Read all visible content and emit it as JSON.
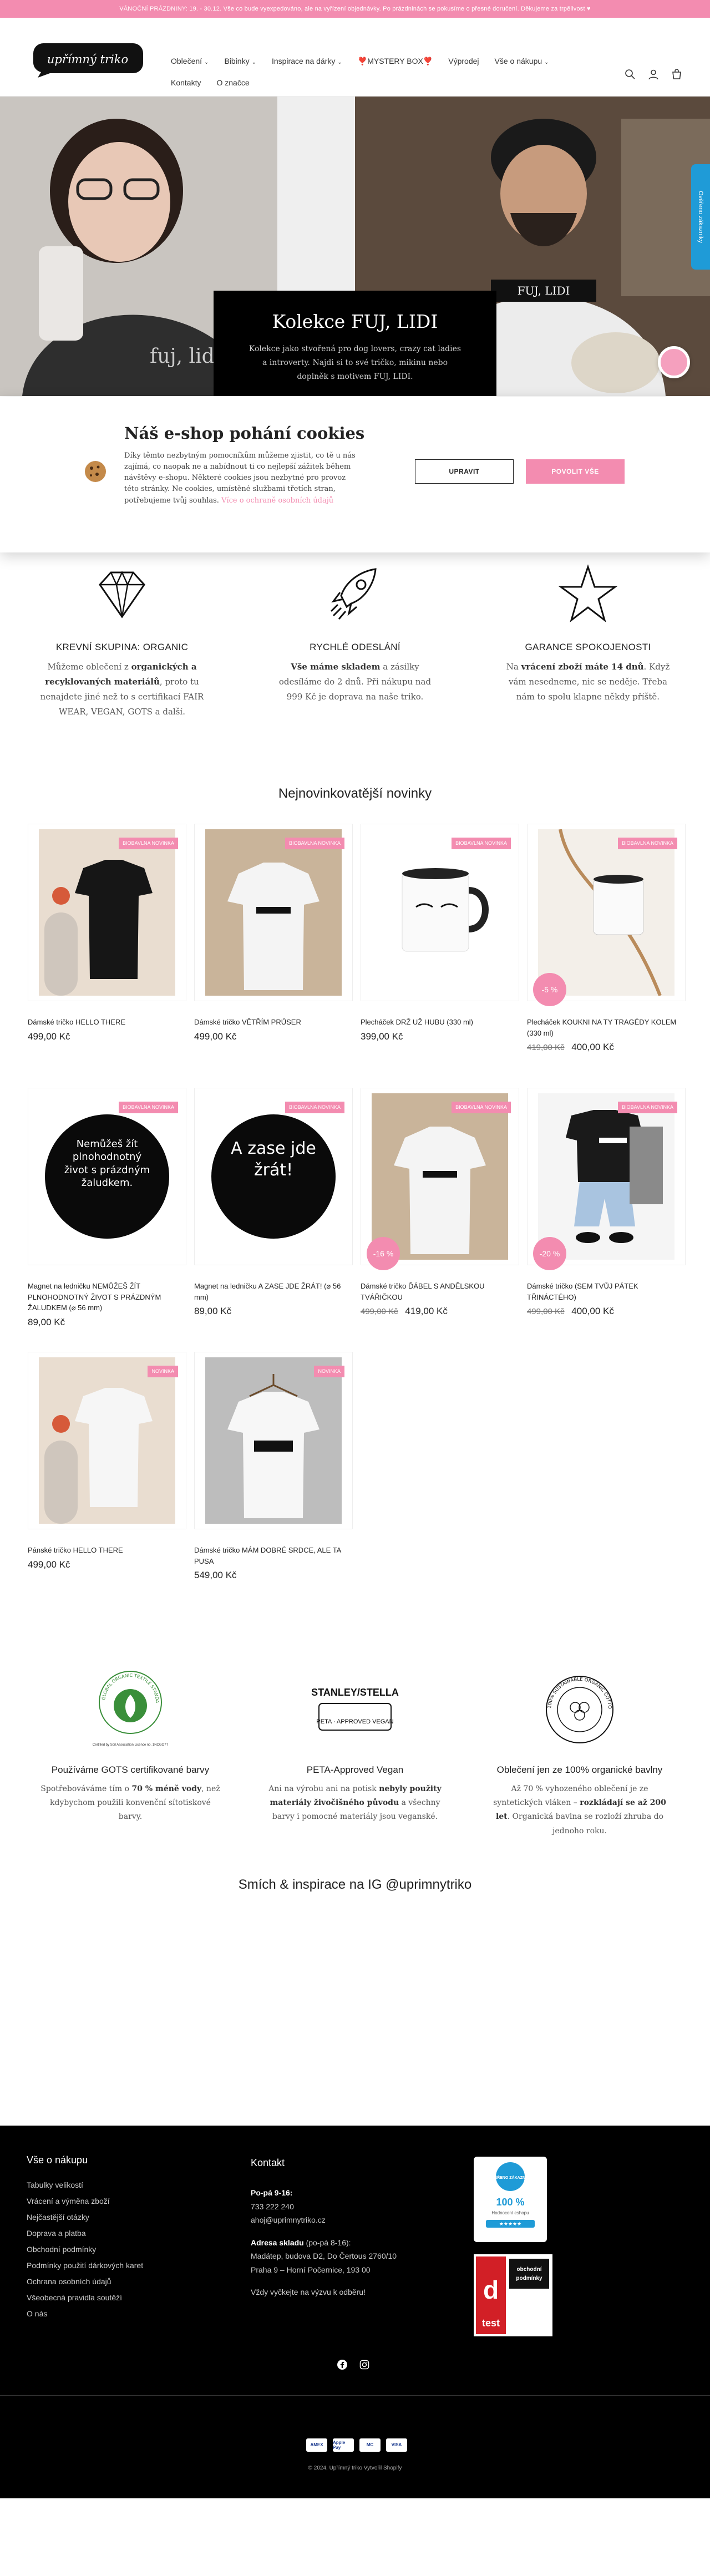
{
  "announcement": "VÁNOČNÍ PRÁZDNINY: 19. - 30.12. Vše co bude vyexpedováno, ale na vyřízení objednávky. Po prázdninách se pokusíme o přesné doručení. Děkujeme za trpělivost ♥",
  "header": {
    "logo_text": "upřímný triko",
    "nav_row1": [
      "Oblečení",
      "Bibinky",
      "Inspirace na dárky",
      "❣️MYSTERY BOX❣️",
      "Výprodej",
      "Vše o nákupu"
    ],
    "nav_row2": [
      "Kontakty",
      "O značce"
    ]
  },
  "hero": {
    "title": "Kolekce FUJ, LIDI",
    "text": "Kolekce jako stvořená pro dog lovers, crazy cat ladies a introverty. Najdi si to své tričko, mikinu nebo doplněk s motivem FUJ, LIDI.",
    "shirt_left": "fuj, lidi",
    "shirt_right": "FUJ, LIDI",
    "side_badge": "Ověřeno zákazníky"
  },
  "cookie": {
    "title": "Náš e-shop pohání cookies",
    "text": "Díky těmto nezbytným pomocníkům můžeme zjistit, co tě u nás zajímá, co naopak ne a nabídnout ti co nejlepší zážitek během návštěvy e-shopu. Některé cookies jsou nezbytné pro provoz této stránky. Ne cookies, umístěné službami třetích stran, potřebujeme tvůj souhlas.",
    "link": "Více o ochraně osobních údajů",
    "upravit": "UPRAVIT",
    "povolit": "POVOLIT VŠE"
  },
  "features": [
    {
      "title": "KREVNÍ SKUPINA: ORGANIC",
      "text_pre": "Můžeme oblečení z ",
      "bold": "organických a recyklovaných materiálů",
      "text_post": ", proto tu nenajdete jiné než to s certifikací FAIR WEAR, VEGAN, GOTS a další."
    },
    {
      "title": "RYCHLÉ ODESLÁNÍ",
      "text_pre": "",
      "bold": "Vše máme skladem",
      "text_post": " a zásilky odesíláme do 2 dnů. Při nákupu nad 999 Kč je doprava na naše triko."
    },
    {
      "title": "GARANCE SPOKOJENOSTI",
      "text_pre": "Na ",
      "bold": "vrácení zboží máte 14 dnů",
      "text_post": ". Když vám nesedneme, nic se neděje. Třeba nám to spolu klapne někdy příště."
    }
  ],
  "new_title": "Nejnovinkovatější novinky",
  "products": [
    {
      "name": "Dámské tričko HELLO THERE",
      "price": "499,00 Kč",
      "old": "",
      "tag": "BIOBAVLNA NOVINKA",
      "sale": "",
      "img": "tee-black"
    },
    {
      "name": "Dámské tričko VĚTŘÍM PRŮSER",
      "price": "499,00 Kč",
      "old": "",
      "tag": "BIOBAVLNA NOVINKA",
      "sale": "",
      "img": "tee-white"
    },
    {
      "name": "Plecháček DRŽ UŽ HUBU (330 ml)",
      "price": "399,00 Kč",
      "old": "",
      "tag": "BIOBAVLNA NOVINKA",
      "sale": "",
      "img": "mug"
    },
    {
      "name": "Plecháček KOUKNI NA TY TRAGÉDY KOLEM (330 ml)",
      "price": "400,00 Kč",
      "old": "419,00 Kč",
      "tag": "BIOBAVLNA NOVINKA",
      "sale": "-5 %",
      "img": "mug-hang"
    },
    {
      "name": "Magnet na ledničku NEMŮŽEŠ ŽÍT PLNOHODNOTNÝ ŽIVOT S PRÁZDNÝM ŽALUDKEM (⌀ 56 mm)",
      "price": "89,00 Kč",
      "old": "",
      "tag": "BIOBAVLNA NOVINKA",
      "sale": "",
      "img": "magnet1",
      "magnet_text": "Nemůžeš žít plnohodnotný život s prázdným žaludkem."
    },
    {
      "name": "Magnet na ledničku A ZASE JDE ŽRÁT! (⌀ 56 mm)",
      "price": "89,00 Kč",
      "old": "",
      "tag": "BIOBAVLNA NOVINKA",
      "sale": "",
      "img": "magnet2",
      "magnet_text": "A zase jde žrát!"
    },
    {
      "name": "Dámské tričko ĎÁBEL S ANDĚLSKOU TVÁŘIČKOU",
      "price": "419,00 Kč",
      "old": "499,00 Kč",
      "tag": "BIOBAVLNA NOVINKA",
      "sale": "-16 %",
      "img": "tee-white"
    },
    {
      "name": "Dámské tričko (SEM TVŮJ PÁTEK TŘINÁCTÉHO)",
      "price": "400,00 Kč",
      "old": "499,00 Kč",
      "tag": "BIOBAVLNA NOVINKA",
      "sale": "-20 %",
      "img": "outfit"
    },
    {
      "name": "Pánské tričko HELLO THERE",
      "price": "499,00 Kč",
      "old": "",
      "tag": "NOVINKA",
      "sale": "",
      "img": "tee-white2"
    },
    {
      "name": "Dámské tričko MÁM DOBRÉ SRDCE, ALE TA PUSA",
      "price": "549,00 Kč",
      "old": "",
      "tag": "NOVINKA",
      "sale": "",
      "img": "tee-hanger"
    }
  ],
  "certs": [
    {
      "title": "Používáme GOTS certifikované barvy",
      "text_pre": "Spotřebováváme tím o ",
      "bold": "70 % méně vody",
      "text_post": ", než kdybychom použili konvenční sítotiskové barvy.",
      "logo": "gots",
      "logo_text": "GLOBAL ORGANIC TEXTILE STANDARD",
      "logo_sub": "Certified by Soil Association Licence no. 1NCGO7T"
    },
    {
      "title": "PETA-Approved Vegan",
      "text_pre": "Ani na výrobu ani na potisk ",
      "bold": "nebyly použity materiály živočišného původu",
      "text_post": " a všechny barvy i pomocné materiály jsou veganské.",
      "logo": "stanley",
      "logo_text": "STANLEY/STELLA",
      "logo_sub": "PETA · APPROVED VEGAN"
    },
    {
      "title": "Oblečení jen ze 100% organické bavlny",
      "text_pre": "Až 70 % vyhozeného oblečení je ze syntetických vláken – ",
      "bold": "rozkládají se až 200 let",
      "text_post": ". Organická bavlna se rozloží zhruba do jednoho roku.",
      "logo": "organic",
      "logo_text": "100% SUSTAINABLE ORGANIC COTTON",
      "logo_sub": ""
    }
  ],
  "ig_title": "Smích & inspirace na IG @uprimnytriko",
  "footer": {
    "col1_title": "Vše o nákupu",
    "links": [
      "Tabulky velikostí",
      "Vrácení a výměna zboží",
      "Nejčastější otázky",
      "Doprava a platba",
      "Obchodní podmínky",
      "Podmínky použití dárkových karet",
      "Ochrana osobních údajů",
      "Všeobecná pravidla soutěží",
      "O nás"
    ],
    "col2_title": "Kontakt",
    "hours_label": "Po-pá 9-16:",
    "phone": "733 222 240",
    "email": "ahoj@uprimnytriko.cz",
    "store_label": "Adresa skladu",
    "store_hours": "(po-pá 8-16):",
    "store_addr1": "Madátep, budova D2, Do Čertous 2760/10",
    "store_addr2": "Praha 9 – Horní Počernice, 193 00",
    "note": "Vždy vyčkejte na výzvu k odběru!",
    "badge1_title": "OVĚŘENO ZÁKAZNÍKY",
    "badge1_pct": "100 %",
    "badge1_sub": "Hodnocení eshopu",
    "badge2_title": "obchodní podmínky",
    "payments": [
      "AMEX",
      "Apple Pay",
      "MC",
      "VISA"
    ],
    "copyright": "© 2024, Upřímný triko Vytvořil Shopify"
  }
}
